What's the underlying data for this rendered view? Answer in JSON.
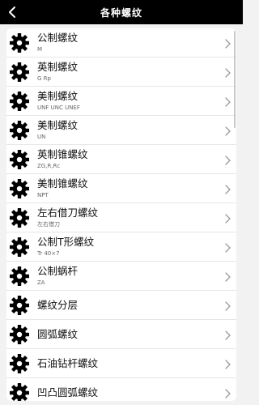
{
  "header": {
    "title": "各种螺纹"
  },
  "icons": {
    "back": "chevron-left-icon",
    "item": "gear-icon",
    "chevron": "chevron-right-icon"
  },
  "colors": {
    "header_bg": "#000000",
    "page_bg": "#f2f2f2",
    "card_bg": "#ffffff"
  },
  "list": [
    {
      "label": "公制螺纹",
      "sub": "M"
    },
    {
      "label": "英制螺纹",
      "sub": "G Rp"
    },
    {
      "label": "美制螺纹",
      "sub": "UNF UNC UNEF"
    },
    {
      "label": "美制螺纹",
      "sub": "UN"
    },
    {
      "label": "英制锥螺纹",
      "sub": "ZG,R,Rc"
    },
    {
      "label": "美制锥螺纹",
      "sub": "NPT"
    },
    {
      "label": "左右借刀螺纹",
      "sub": "左右借刀"
    },
    {
      "label": "公制T形螺纹",
      "sub": "Tr 40×7"
    },
    {
      "label": "公制蜗杆",
      "sub": "ZA"
    },
    {
      "label": "螺纹分层",
      "sub": ""
    },
    {
      "label": "圆弧螺纹",
      "sub": ""
    },
    {
      "label": "石油钻杆螺纹",
      "sub": ""
    },
    {
      "label": "凹凸圆弧螺纹",
      "sub": ""
    }
  ]
}
